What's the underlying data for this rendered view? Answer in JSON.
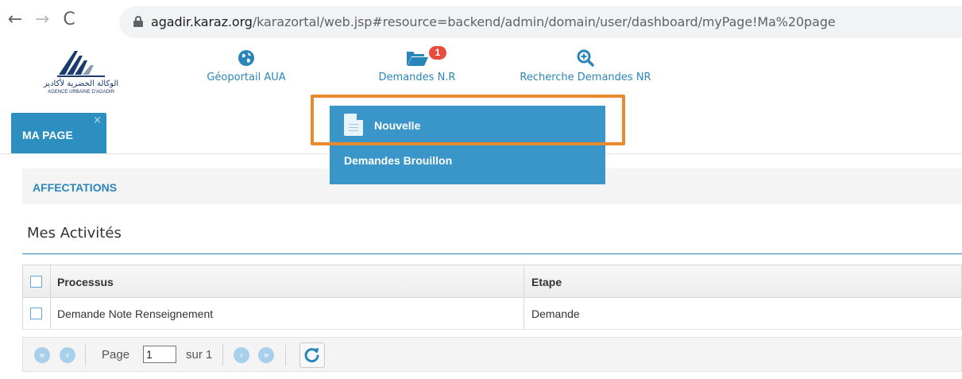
{
  "browser": {
    "url_host": "agadir.karaz.org",
    "url_path": "/karazortal/web.jsp#resource=backend/admin/domain/user/dashboard/myPage!Ma%20page"
  },
  "logo": {
    "arabic_text": "الوكالة الحضرية لأكادير",
    "french_text": "AGENCE URBAINE D'AGADIR"
  },
  "top_nav": {
    "geoportail": "Géoportail AUA",
    "demandes": "Demandes N.R",
    "demandes_badge": "1",
    "recherche": "Recherche Demandes NR"
  },
  "tabs": {
    "ma_page": "MA PAGE",
    "close_glyph": "×"
  },
  "dropdown": {
    "nouvelle": "Nouvelle",
    "brouillon": "Demandes Brouillon"
  },
  "affectations": {
    "label": "AFFECTATIONS"
  },
  "activities": {
    "title": "Mes Activités",
    "columns": [
      "Processus",
      "Etape"
    ],
    "rows": [
      {
        "processus": "Demande Note Renseignement",
        "etape": "Demande"
      }
    ]
  },
  "pager": {
    "page_label": "Page",
    "page_value": "1",
    "of_label": "sur 1"
  },
  "colors": {
    "accent": "#2a86b8",
    "dropdown": "#3a96c8",
    "highlight": "#e88a2e",
    "badge": "#e74c3c"
  }
}
